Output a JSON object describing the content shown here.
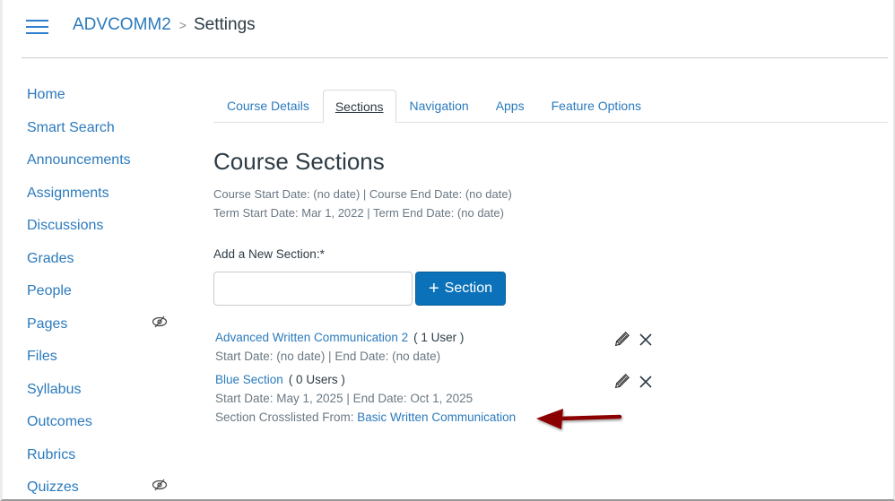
{
  "header": {
    "menu_icon": "hamburger-icon",
    "breadcrumb": {
      "course": "ADVCOMM2",
      "separator": ">",
      "current": "Settings"
    }
  },
  "sidebar": {
    "items": [
      {
        "label": "Home",
        "hidden": false
      },
      {
        "label": "Smart Search",
        "hidden": false
      },
      {
        "label": "Announcements",
        "hidden": false
      },
      {
        "label": "Assignments",
        "hidden": false
      },
      {
        "label": "Discussions",
        "hidden": false
      },
      {
        "label": "Grades",
        "hidden": false
      },
      {
        "label": "People",
        "hidden": false
      },
      {
        "label": "Pages",
        "hidden": true
      },
      {
        "label": "Files",
        "hidden": false
      },
      {
        "label": "Syllabus",
        "hidden": false
      },
      {
        "label": "Outcomes",
        "hidden": false
      },
      {
        "label": "Rubrics",
        "hidden": false
      },
      {
        "label": "Quizzes",
        "hidden": true
      }
    ],
    "hidden_icon": "eye-slash-icon"
  },
  "tabs": [
    {
      "label": "Course Details",
      "active": false
    },
    {
      "label": "Sections",
      "active": true
    },
    {
      "label": "Navigation",
      "active": false
    },
    {
      "label": "Apps",
      "active": false
    },
    {
      "label": "Feature Options",
      "active": false
    }
  ],
  "main": {
    "title": "Course Sections",
    "course_dates": "Course Start Date: (no date) | Course End Date: (no date)",
    "term_dates": "Term Start Date: Mar 1, 2022 | Term End Date: (no date)",
    "add_section": {
      "label": "Add a New Section:*",
      "input_value": "",
      "button_icon": "+",
      "button_label": "Section"
    },
    "sections": [
      {
        "name": "Advanced Written Communication 2",
        "count": "( 1 User )",
        "dates": "Start Date: (no date) | End Date: (no date)"
      },
      {
        "name": "Blue Section",
        "count": "( 0 Users )",
        "dates": "Start Date: May 1, 2025 | End Date: Oct 1, 2025",
        "crosslist_label": "Section Crosslisted From: ",
        "crosslist_link": "Basic Written Communication"
      }
    ]
  },
  "colors": {
    "link": "#2b7abc",
    "primary_button": "#0b72b9",
    "text": "#2d3b45",
    "muted_text": "#6a7883",
    "annotation_arrow": "#8b0000"
  }
}
